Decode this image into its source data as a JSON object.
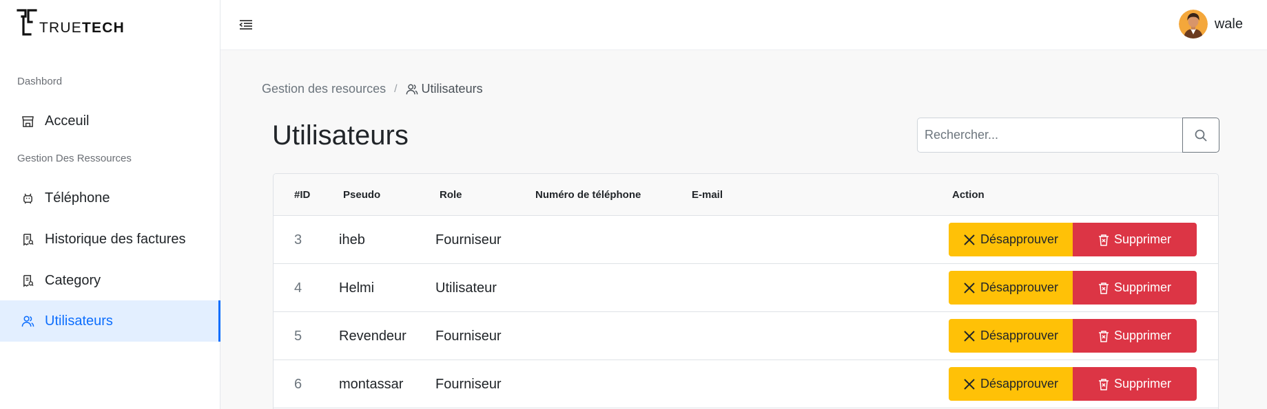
{
  "brand": {
    "logo_text_light": "TRUE",
    "logo_text_bold": "TECH"
  },
  "sidebar": {
    "sections": [
      {
        "label": "Dashbord"
      },
      {
        "label": "Gestion Des Ressources"
      }
    ],
    "items": [
      {
        "label": "Acceuil",
        "icon": "store-icon"
      },
      {
        "label": "Téléphone",
        "icon": "android-icon"
      },
      {
        "label": "Historique des factures",
        "icon": "receipt-icon"
      },
      {
        "label": "Category",
        "icon": "receipt-icon"
      },
      {
        "label": "Utilisateurs",
        "icon": "users-icon",
        "active": true
      }
    ]
  },
  "topbar": {
    "username": "wale"
  },
  "breadcrumb": {
    "parent": "Gestion des resources",
    "separator": "/",
    "current": "Utilisateurs"
  },
  "page": {
    "title": "Utilisateurs"
  },
  "search": {
    "placeholder": "Rechercher..."
  },
  "table": {
    "columns": [
      "#ID",
      "Pseudo",
      "Role",
      "Numéro de téléphone",
      "E-mail",
      "Action"
    ],
    "rows": [
      {
        "id": "3",
        "pseudo": "iheb",
        "role": "Fourniseur",
        "phone": "",
        "email": ""
      },
      {
        "id": "4",
        "pseudo": "Helmi",
        "role": "Utilisateur",
        "phone": "",
        "email": ""
      },
      {
        "id": "5",
        "pseudo": "Revendeur",
        "role": "Fourniseur",
        "phone": "",
        "email": ""
      },
      {
        "id": "6",
        "pseudo": "montassar",
        "role": "Fourniseur",
        "phone": "",
        "email": ""
      }
    ],
    "actions": {
      "disapprove_label": "Désapprouver",
      "delete_label": "Supprimer"
    }
  },
  "colors": {
    "accent": "#0d6efd",
    "warning": "#ffc107",
    "danger": "#dc3545"
  }
}
